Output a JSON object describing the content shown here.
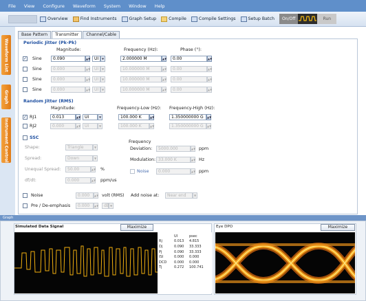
{
  "menu": [
    "File",
    "View",
    "Configure",
    "Waveform",
    "System",
    "Window",
    "Help"
  ],
  "toolbar": {
    "overview": "Overview",
    "find": "Find Instruments",
    "graph": "Graph Setup",
    "compile": "Compile",
    "compile_settings": "Compile Settings",
    "setup_batch": "Setup Batch",
    "onoff": "On/Off",
    "run": "Run"
  },
  "left_tabs": [
    "Waveform List",
    "Graph",
    "Instrument Control"
  ],
  "tabs": [
    "Base Pattern",
    "Transmitter",
    "Channel/Cable"
  ],
  "pj": {
    "title": "Periodic Jitter (Pk-Pk)",
    "h_mag": "Magnitude:",
    "h_freq": "Frequency (Hz):",
    "h_phase": "Phase (°):",
    "rows": [
      {
        "label": "Sine",
        "mag": "0.090",
        "unit": "UI",
        "freq": "2.000000 M",
        "phase": "0.00"
      },
      {
        "label": "Sine",
        "mag": "0.000",
        "unit": "UI",
        "freq": "10.000000 M",
        "phase": "0.00"
      },
      {
        "label": "Sine",
        "mag": "0.000",
        "unit": "UI",
        "freq": "10.000000 M",
        "phase": "0.00"
      },
      {
        "label": "Sine",
        "mag": "0.000",
        "unit": "UI",
        "freq": "10.000000 M",
        "phase": "0.00"
      }
    ]
  },
  "rj": {
    "title": "Random Jitter (RMS)",
    "h_mag": "Magnitude:",
    "h_flow": "Frequency-Low (Hz):",
    "h_fhigh": "Frequency-High (Hz):",
    "rows": [
      {
        "label": "RJ1",
        "mag": "0.013",
        "unit": "UI",
        "flow": "100.000 K",
        "fhigh": "1.350000000 G"
      },
      {
        "label": "RJ2",
        "mag": "0.000",
        "unit": "UI",
        "flow": "100.000 K",
        "fhigh": "1.350000000 G"
      }
    ]
  },
  "ssc": {
    "label": "SSC",
    "shape_label": "Shape:",
    "shape": "Triangle",
    "spread_label": "Spread:",
    "spread": "Down",
    "unequal_label": "Unequal Spread:",
    "unequal": "50.00",
    "unequal_unit": "%",
    "dfdt_label": "df/dt:",
    "dfdt": "0.000",
    "dfdt_unit": "ppm/us",
    "freq_label": "Frequency",
    "dev_label": "Deviation:",
    "dev": "5000.000",
    "dev_unit": "ppm",
    "mod_label": "Modulation:",
    "mod": "33.000 K",
    "mod_unit": "Hz",
    "noise_label": "Noise",
    "noise": "0.000",
    "noise_unit": "ppm"
  },
  "noise": {
    "label": "Noise",
    "value": "0.000",
    "unit": "volt (RMS)",
    "add_label": "Add noise at:",
    "add_value": "Near end"
  },
  "preemph": {
    "label": "Pre / De-emphasis",
    "value": "0.000",
    "unit": "dB"
  },
  "graph_bar": "Graph",
  "sim": {
    "title": "Simulated Data Signal",
    "maximize": "Maximize"
  },
  "eye": {
    "title": "Eye DPO",
    "maximize": "Maximize"
  },
  "meas": {
    "headers": [
      "",
      "UI",
      "psec"
    ],
    "rows": [
      [
        "Rj",
        "0.013",
        "4.815"
      ],
      [
        "Dj",
        "0.090",
        "33.333"
      ],
      [
        "Pj",
        "0.090",
        "33.333"
      ],
      [
        "ISI",
        "0.000",
        "0.000"
      ],
      [
        "DCD",
        "0.000",
        "0.000"
      ],
      [
        "Tj",
        "0.272",
        "100.741"
      ]
    ]
  },
  "colors": {
    "menubar": "#5f8fca",
    "accent": "#1e4fa0",
    "trace": "#f2b010",
    "left_tab": "#e8861f"
  }
}
